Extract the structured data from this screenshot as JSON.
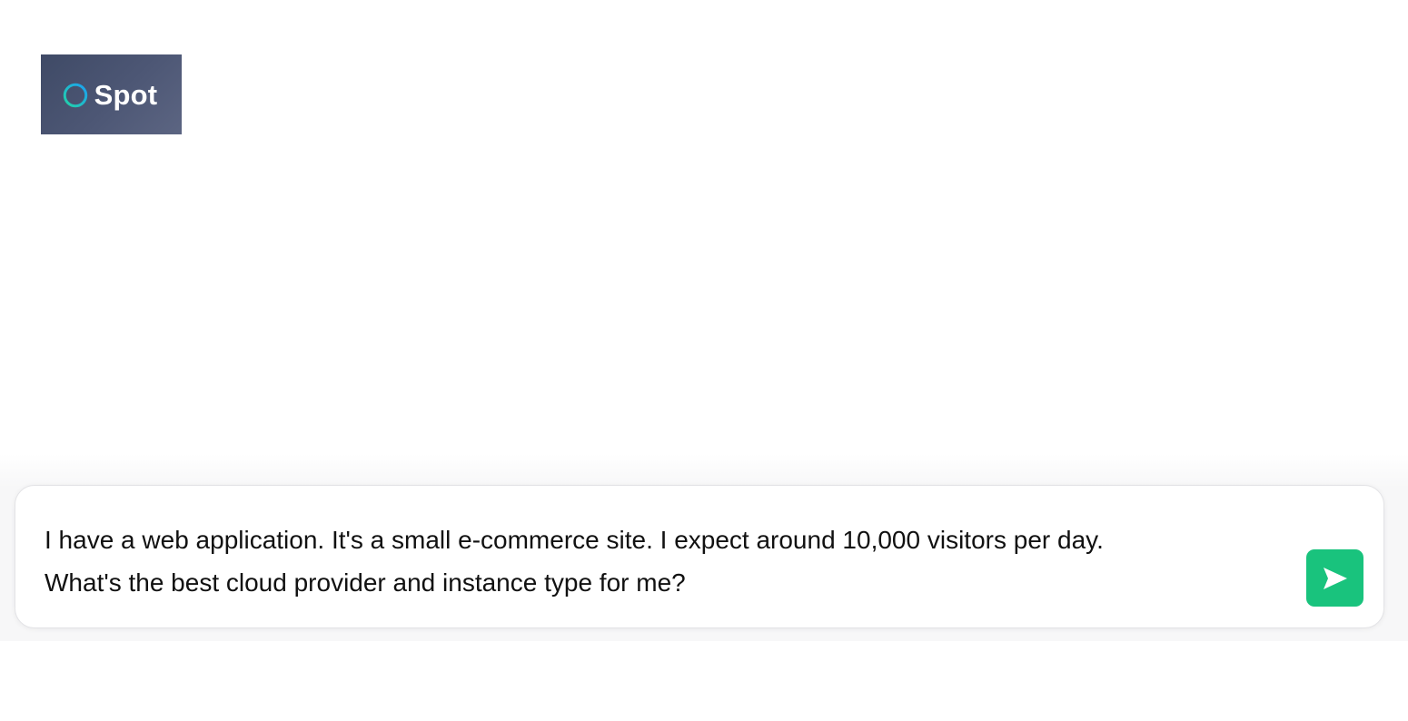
{
  "brand": {
    "name": "Spot",
    "icon": "ring-logo-icon",
    "colors": {
      "badge_background": "#4a5470",
      "ring_start": "#22d3a6",
      "ring_end": "#1ba0f2"
    }
  },
  "composer": {
    "message": "I have a web application. It's a small e-commerce site. I expect around 10,000 visitors per day.\nWhat's the best cloud provider and instance type for me?",
    "send_icon": "send-arrow-icon",
    "send_color": "#19c37d"
  }
}
